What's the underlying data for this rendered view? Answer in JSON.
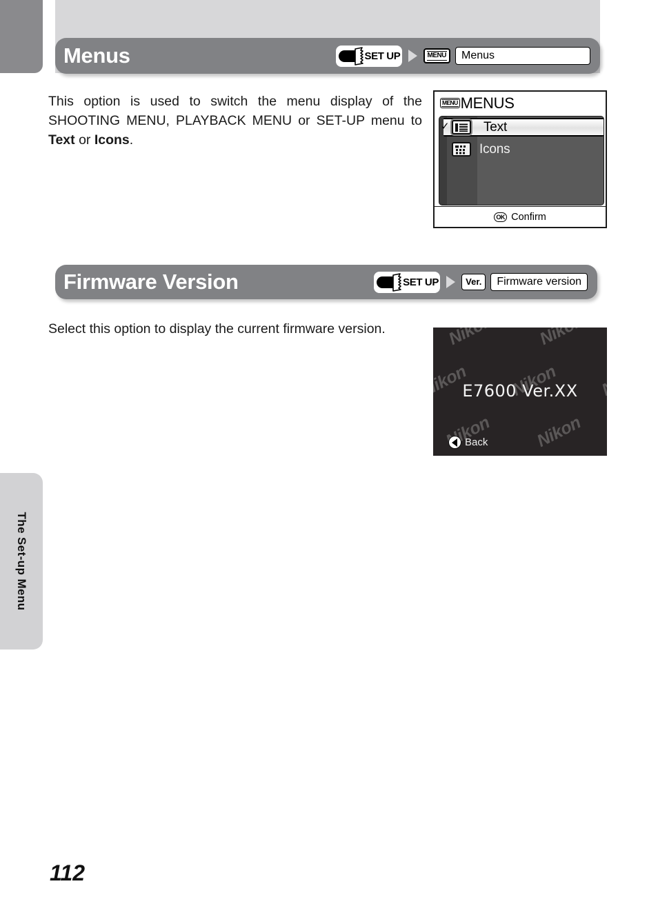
{
  "page": {
    "number": "112",
    "chapter_tab": "The Set-up Menu",
    "colors": {
      "band": "#d7d7d9",
      "header_bar": "#818285",
      "tab_dark": "#8a8a8d",
      "tab_light": "#d2d2d4",
      "lcd_dark": "#282425",
      "lcd_panel": "#5a5a5a"
    }
  },
  "sections": [
    {
      "title": "Menus",
      "breadcrumb": {
        "dial_label": "SET UP",
        "dial_icon": "mode-dial-icon",
        "arrow_icon": "arrow-right-icon",
        "chip_label": "MENU",
        "chip_icon": "menu-chip-icon",
        "value": "Menus"
      },
      "body": {
        "line1": "This option is used to switch the menu display of the",
        "line2": "SHOOTING MENU, PLAYBACK MENU or SET-UP menu to",
        "bold1": "Text",
        "joiner": " or ",
        "bold2": "Icons",
        "period": "."
      },
      "screen": {
        "kind": "menus-screen",
        "header_chip": "MENU",
        "header_title": "MENUS",
        "items": [
          {
            "label": "Text",
            "icon": "list-lines-icon",
            "checked": "✓",
            "selected": true
          },
          {
            "label": "Icons",
            "icon": "icon-grid-icon",
            "checked": "",
            "selected": false
          }
        ],
        "footer": {
          "button": "OK",
          "label": "Confirm"
        }
      }
    },
    {
      "title": "Firmware Version",
      "breadcrumb": {
        "dial_label": "SET UP",
        "dial_icon": "mode-dial-icon",
        "arrow_icon": "arrow-right-icon",
        "chip_label": "Ver.",
        "chip_icon": "version-chip-icon",
        "value": "Firmware version"
      },
      "body": {
        "line1": "Select this option to display the current firmware version."
      },
      "screen": {
        "kind": "firmware-screen",
        "version_text": "E7600 Ver.XX",
        "watermark_text": "Nikon",
        "footer": {
          "button": "back-arrow",
          "label": "Back"
        }
      }
    }
  ]
}
